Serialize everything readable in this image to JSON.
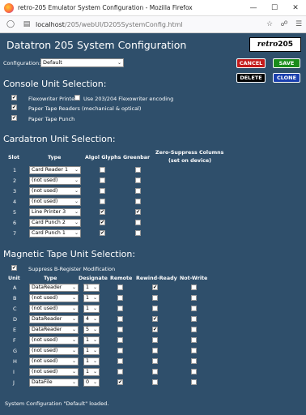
{
  "window": {
    "title": "retro-205 Emulator System Configuration - Mozilla Firefox",
    "url_host": "localhost",
    "url_path": "/205/webUI/D205SystemConfig.html"
  },
  "header": {
    "title": "Datatron 205 System Configuration",
    "logo_text": "retro",
    "logo_number": "205"
  },
  "config": {
    "label": "Configuration:",
    "selected": "Default"
  },
  "buttons": {
    "cancel": "CANCEL",
    "save": "SAVE",
    "delete": "DELETE",
    "clone": "CLONE"
  },
  "console": {
    "heading": "Console Unit Selection:",
    "items": [
      {
        "label": "Flexowriter Printer",
        "checked": true
      },
      {
        "label": "Use 203/204 Flexowriter encoding",
        "checked": false
      },
      {
        "label": "Paper Tape Readers (mechanical & optical)",
        "checked": true
      },
      {
        "label": "Paper Tape Punch",
        "checked": true
      }
    ]
  },
  "cardatron": {
    "heading": "Cardatron Unit Selection:",
    "headers": {
      "slot": "Slot",
      "type": "Type",
      "algol": "Algol Glyphs",
      "greenbar": "Greenbar",
      "zero_suppress_1": "Zero-Suppress Columns",
      "zero_suppress_2": "(set on device)"
    },
    "rows": [
      {
        "slot": "1",
        "type": "Card Reader 1",
        "algol": false,
        "greenbar": false
      },
      {
        "slot": "2",
        "type": "(not used)",
        "algol": false,
        "greenbar": false
      },
      {
        "slot": "3",
        "type": "(not used)",
        "algol": false,
        "greenbar": false
      },
      {
        "slot": "4",
        "type": "(not used)",
        "algol": false,
        "greenbar": false
      },
      {
        "slot": "5",
        "type": "Line Printer 3",
        "algol": true,
        "greenbar": true
      },
      {
        "slot": "6",
        "type": "Card Punch 2",
        "algol": true,
        "greenbar": false
      },
      {
        "slot": "7",
        "type": "Card Punch 1",
        "algol": true,
        "greenbar": false
      }
    ]
  },
  "magtape": {
    "heading": "Magnetic Tape Unit Selection:",
    "suppress_label": "Suppress B-Register Modification",
    "suppress_checked": true,
    "headers": {
      "unit": "Unit",
      "type": "Type",
      "designate": "Designate",
      "remote": "Remote",
      "rewind": "Rewind-Ready",
      "notwrite": "Not-Write"
    },
    "rows": [
      {
        "unit": "A",
        "type": "DataReader",
        "designate": "1",
        "remote": false,
        "rewind": true,
        "notwrite": false
      },
      {
        "unit": "B",
        "type": "(not used)",
        "designate": "1",
        "remote": false,
        "rewind": false,
        "notwrite": false
      },
      {
        "unit": "C",
        "type": "(not used)",
        "designate": "1",
        "remote": false,
        "rewind": false,
        "notwrite": false
      },
      {
        "unit": "D",
        "type": "DataReader",
        "designate": "4",
        "remote": false,
        "rewind": true,
        "notwrite": false
      },
      {
        "unit": "E",
        "type": "DataReader",
        "designate": "5",
        "remote": false,
        "rewind": true,
        "notwrite": false
      },
      {
        "unit": "F",
        "type": "(not used)",
        "designate": "1",
        "remote": false,
        "rewind": false,
        "notwrite": false
      },
      {
        "unit": "G",
        "type": "(not used)",
        "designate": "1",
        "remote": false,
        "rewind": false,
        "notwrite": false
      },
      {
        "unit": "H",
        "type": "(not used)",
        "designate": "1",
        "remote": false,
        "rewind": false,
        "notwrite": false
      },
      {
        "unit": "I",
        "type": "(not used)",
        "designate": "1",
        "remote": false,
        "rewind": false,
        "notwrite": false
      },
      {
        "unit": "J",
        "type": "DataFile",
        "designate": "0",
        "remote": true,
        "rewind": false,
        "notwrite": false
      }
    ]
  },
  "status": "System Configuration \"Default\" loaded.",
  "icons": {
    "back": "arrow-left-icon",
    "page": "page-info-icon",
    "shield": "shield-icon",
    "menu": "hamburger-menu-icon"
  },
  "colors": {
    "background": "#2f4f6b",
    "cancel": "#c41b1b",
    "save": "#1a8c1a",
    "delete": "#000000",
    "clone": "#1a3fae"
  }
}
